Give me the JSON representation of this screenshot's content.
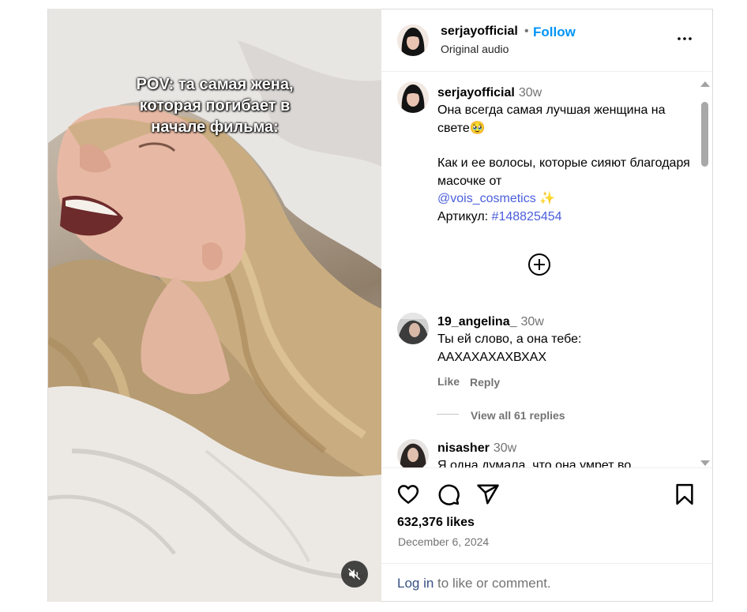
{
  "video": {
    "overlay_text": "POV: та самая жена, которая погибает в начале фильма:",
    "mute_icon": "speaker-muted-icon"
  },
  "header": {
    "username": "serjayofficial",
    "separator": "•",
    "follow_label": "Follow",
    "subtitle": "Original audio",
    "more_icon": "more-horizontal-icon"
  },
  "caption": {
    "username": "serjayofficial",
    "time": "30w",
    "line1": "Она всегда самая лучшая женщина на свете🥹",
    "line2": "Как и ее волосы, которые сияют благодаря масочке от",
    "mention": "@vois_cosmetics",
    "sparkle": "✨",
    "article_label": "Артикул: ",
    "hashtag": "#148825454"
  },
  "load_more_icon": "plus-circle-icon",
  "comments": [
    {
      "username": "19_angelina_",
      "time": "30w",
      "text_line1": "Ты ей слово, а она тебе:",
      "text_line2": "ААХАХАХАХВХАХ",
      "like_label": "Like",
      "reply_label": "Reply",
      "view_replies": "View all 61 replies"
    },
    {
      "username": "nisasher",
      "time": "30w",
      "text_line1": "Я одна думала, что она умрет во"
    }
  ],
  "actions": {
    "icons": [
      "heart-icon",
      "comment-icon",
      "share-icon",
      "bookmark-icon"
    ],
    "likes": "632,376 likes",
    "date": "December 6, 2024",
    "login_link": "Log in",
    "login_rest": " to like or comment."
  }
}
